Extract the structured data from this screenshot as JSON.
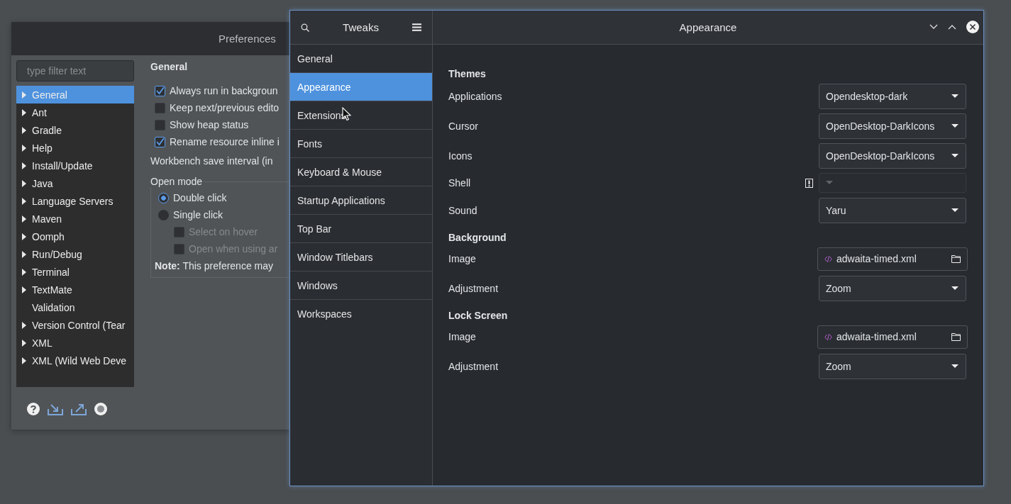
{
  "preferences": {
    "title": "Preferences",
    "filter_placeholder": "type filter text",
    "tree": [
      {
        "label": "General",
        "expandable": true,
        "selected": true
      },
      {
        "label": "Ant",
        "expandable": true,
        "selected": false
      },
      {
        "label": "Gradle",
        "expandable": true,
        "selected": false
      },
      {
        "label": "Help",
        "expandable": true,
        "selected": false
      },
      {
        "label": "Install/Update",
        "expandable": true,
        "selected": false
      },
      {
        "label": "Java",
        "expandable": true,
        "selected": false
      },
      {
        "label": "Language Servers",
        "expandable": true,
        "selected": false
      },
      {
        "label": "Maven",
        "expandable": true,
        "selected": false
      },
      {
        "label": "Oomph",
        "expandable": true,
        "selected": false
      },
      {
        "label": "Run/Debug",
        "expandable": true,
        "selected": false
      },
      {
        "label": "Terminal",
        "expandable": true,
        "selected": false
      },
      {
        "label": "TextMate",
        "expandable": true,
        "selected": false
      },
      {
        "label": "Validation",
        "expandable": false,
        "selected": false
      },
      {
        "label": "Version Control (Tear",
        "expandable": true,
        "selected": false
      },
      {
        "label": "XML",
        "expandable": true,
        "selected": false
      },
      {
        "label": "XML (Wild Web Deve",
        "expandable": true,
        "selected": false
      }
    ],
    "section_title": "General",
    "options": [
      {
        "label": "Always run in backgroun",
        "checked": true
      },
      {
        "label": "Keep next/previous edito",
        "checked": false
      },
      {
        "label": "Show heap status",
        "checked": false
      },
      {
        "label": "Rename resource inline i",
        "checked": true
      }
    ],
    "save_interval_label": "Workbench save interval (in",
    "open_mode": {
      "label": "Open mode",
      "options": [
        {
          "label": "Double click",
          "selected": true
        },
        {
          "label": "Single click",
          "selected": false
        }
      ],
      "sub_options": [
        {
          "label": "Select on hover",
          "checked": false,
          "disabled": true
        },
        {
          "label": "Open when using ar",
          "checked": false,
          "disabled": true
        }
      ],
      "note": "**Note:** This preference may"
    }
  },
  "tweaks": {
    "title": "Tweaks",
    "page_title": "Appearance",
    "menu": [
      {
        "label": "General",
        "selected": false
      },
      {
        "label": "Appearance",
        "selected": true
      },
      {
        "label": "Extensions",
        "selected": false
      },
      {
        "label": "Fonts",
        "selected": false
      },
      {
        "label": "Keyboard & Mouse",
        "selected": false
      },
      {
        "label": "Startup Applications",
        "selected": false
      },
      {
        "label": "Top Bar",
        "selected": false
      },
      {
        "label": "Window Titlebars",
        "selected": false
      },
      {
        "label": "Windows",
        "selected": false
      },
      {
        "label": "Workspaces",
        "selected": false
      }
    ],
    "sections": [
      {
        "title": "Themes",
        "rows": [
          {
            "kind": "dropdown",
            "label": "Applications",
            "value": "Opendesktop-dark",
            "disabled": false
          },
          {
            "kind": "dropdown",
            "label": "Cursor",
            "value": "OpenDesktop-DarkIcons",
            "disabled": false
          },
          {
            "kind": "dropdown",
            "label": "Icons",
            "value": "OpenDesktop-DarkIcons",
            "disabled": false
          },
          {
            "kind": "dropdown",
            "label": "Shell",
            "disabled": true,
            "warning": true
          },
          {
            "kind": "dropdown",
            "label": "Sound",
            "value": "Yaru",
            "disabled": false
          }
        ]
      },
      {
        "title": "Background",
        "rows": [
          {
            "kind": "file",
            "label": "Image",
            "value": "adwaita-timed.xml"
          },
          {
            "kind": "dropdown",
            "label": "Adjustment",
            "value": "Zoom",
            "disabled": false
          }
        ]
      },
      {
        "title": "Lock Screen",
        "rows": [
          {
            "kind": "file",
            "label": "Image",
            "value": "adwaita-timed.xml"
          },
          {
            "kind": "dropdown",
            "label": "Adjustment",
            "value": "Zoom",
            "disabled": false
          }
        ]
      }
    ]
  }
}
